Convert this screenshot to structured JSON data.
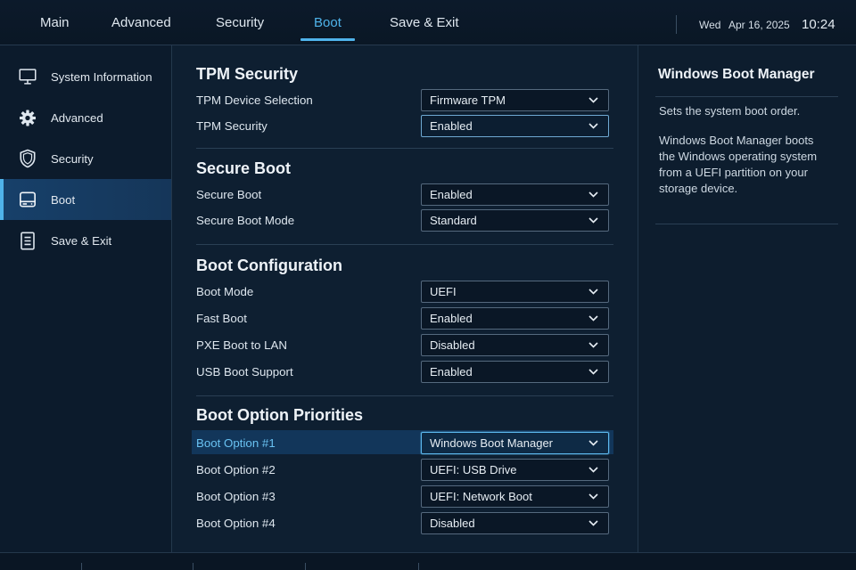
{
  "tabs": [
    {
      "label": "Main"
    },
    {
      "label": "Advanced"
    },
    {
      "label": "Security"
    },
    {
      "label": "Boot",
      "active": true
    },
    {
      "label": "Save & Exit"
    }
  ],
  "clock": {
    "day": "Wed",
    "date": "Apr 16, 2025",
    "time": "10:24"
  },
  "sidebar": {
    "items": [
      {
        "label": "System Information",
        "icon": "monitor-icon"
      },
      {
        "label": "Advanced",
        "icon": "gear-icon"
      },
      {
        "label": "Security",
        "icon": "shield-icon"
      },
      {
        "label": "Boot",
        "icon": "drive-icon",
        "active": true
      },
      {
        "label": "Save & Exit",
        "icon": "document-icon"
      }
    ]
  },
  "sections": [
    {
      "title": "TPM Security",
      "rows": [
        {
          "label": "TPM Device Selection",
          "value": "Firmware TPM"
        },
        {
          "label": "TPM Security",
          "value": "Enabled"
        }
      ]
    },
    {
      "title": "Secure Boot",
      "rows": [
        {
          "label": "Secure Boot",
          "value": "Enabled"
        },
        {
          "label": "Secure Boot Mode",
          "value": "Standard"
        }
      ]
    },
    {
      "title": "Boot Configuration",
      "rows": [
        {
          "label": "Boot Mode",
          "value": "UEFI"
        },
        {
          "label": "Fast Boot",
          "value": "Enabled"
        },
        {
          "label": "PXE Boot to LAN",
          "value": "Disabled"
        },
        {
          "label": "USB Boot Support",
          "value": "Enabled"
        }
      ]
    },
    {
      "title": "Boot Option Priorities",
      "rows": [
        {
          "label": "Boot Option #1",
          "value": "Windows Boot Manager",
          "selected": true
        },
        {
          "label": "Boot Option #2",
          "value": "UEFI: USB Drive"
        },
        {
          "label": "Boot Option #3",
          "value": "UEFI: Network Boot"
        },
        {
          "label": "Boot Option #4",
          "value": "Disabled"
        }
      ]
    }
  ],
  "help": {
    "title": "Windows Boot Manager",
    "summary": "Sets the system boot order.",
    "description": "Windows Boot Manager boots the Windows operating system from a UEFI partition on your storage device."
  },
  "colors": {
    "background": "#0b1828",
    "accent": "#4fb3ea",
    "selected_row": "#12365a",
    "text": "#e4ebf2"
  }
}
